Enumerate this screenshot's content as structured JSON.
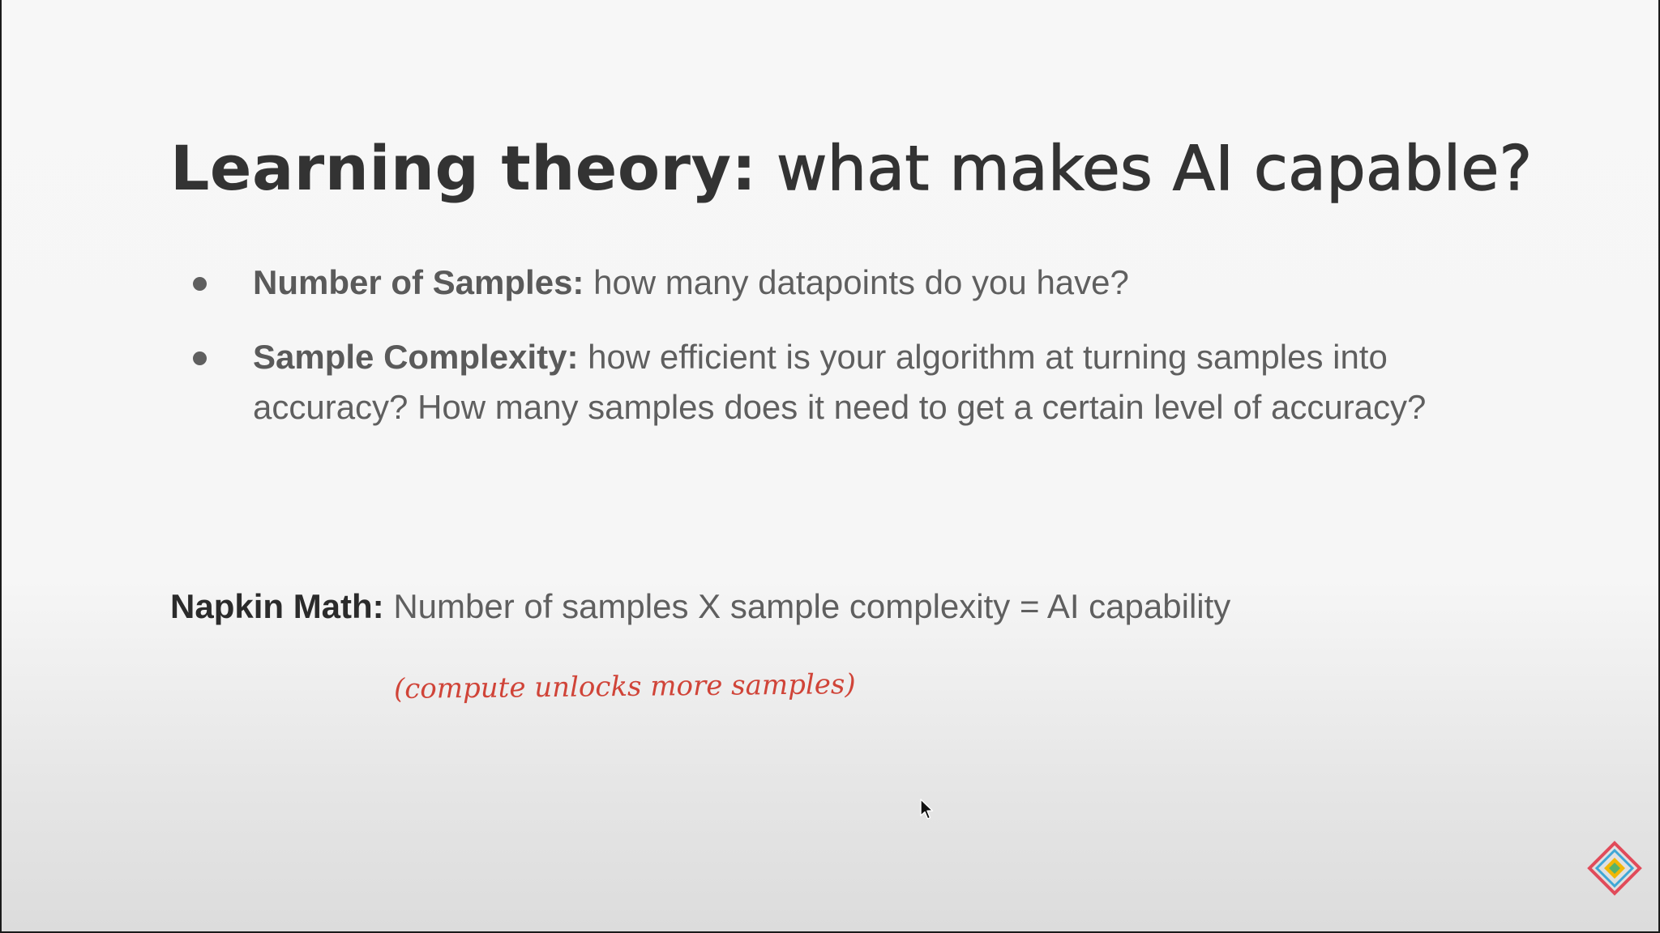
{
  "slide": {
    "title_bold": "Learning theory:",
    "title_rest": " what makes AI capable?",
    "bullets": [
      {
        "term": "Number of Samples:",
        "text": " how many datapoints do you have?"
      },
      {
        "term": "Sample Complexity:",
        "text": " how efficient is your algorithm at turning samples into accuracy? How many samples does it need to get a certain level of accuracy?"
      }
    ],
    "napkin": {
      "term": "Napkin Math:",
      "text": " Number of samples X sample complexity = AI capability"
    },
    "handwritten_note": "(compute unlocks more samples)"
  },
  "colors": {
    "title": "#333333",
    "body_text": "#5f5f5f",
    "annotation": "#d04438",
    "background": "#f6f6f6"
  },
  "icons": {
    "cursor": "mouse-pointer-icon",
    "logo": "diamond-logo-icon"
  }
}
